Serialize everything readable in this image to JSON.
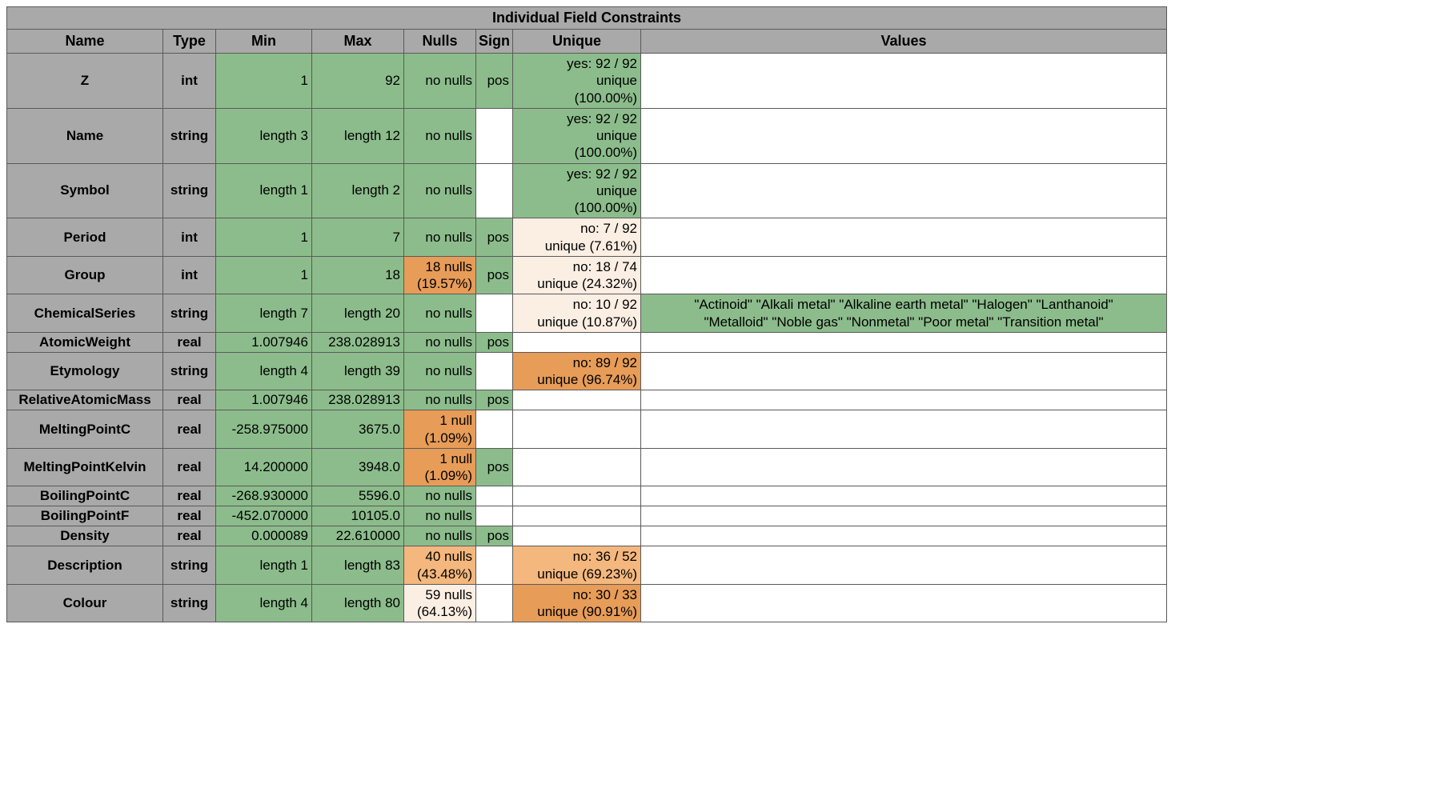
{
  "title": "Individual Field Constraints",
  "headers": {
    "name": "Name",
    "type": "Type",
    "min": "Min",
    "max": "Max",
    "nulls": "Nulls",
    "sign": "Sign",
    "unique": "Unique",
    "values": "Values"
  },
  "rows": [
    {
      "name": "Z",
      "type": "int",
      "min": {
        "t": "1",
        "c": "g"
      },
      "max": {
        "t": "92",
        "c": "g"
      },
      "nulls": {
        "t": "no nulls",
        "c": "g"
      },
      "sign": {
        "t": "pos",
        "c": "g"
      },
      "unique": {
        "t": "yes: 92 / 92\nunique\n(100.00%)",
        "c": "g"
      },
      "values": {
        "t": "",
        "c": "w"
      }
    },
    {
      "name": "Name",
      "type": "string",
      "min": {
        "t": "length 3",
        "c": "g"
      },
      "max": {
        "t": "length 12",
        "c": "g"
      },
      "nulls": {
        "t": "no nulls",
        "c": "g"
      },
      "sign": {
        "t": "",
        "c": "w"
      },
      "unique": {
        "t": "yes: 92 / 92\nunique\n(100.00%)",
        "c": "g"
      },
      "values": {
        "t": "",
        "c": "w"
      }
    },
    {
      "name": "Symbol",
      "type": "string",
      "min": {
        "t": "length 1",
        "c": "g"
      },
      "max": {
        "t": "length 2",
        "c": "g"
      },
      "nulls": {
        "t": "no nulls",
        "c": "g"
      },
      "sign": {
        "t": "",
        "c": "w"
      },
      "unique": {
        "t": "yes: 92 / 92\nunique\n(100.00%)",
        "c": "g"
      },
      "values": {
        "t": "",
        "c": "w"
      }
    },
    {
      "name": "Period",
      "type": "int",
      "min": {
        "t": "1",
        "c": "g"
      },
      "max": {
        "t": "7",
        "c": "g"
      },
      "nulls": {
        "t": "no nulls",
        "c": "g"
      },
      "sign": {
        "t": "pos",
        "c": "g"
      },
      "unique": {
        "t": "no: 7 / 92\nunique (7.61%)",
        "c": "vlo"
      },
      "values": {
        "t": "",
        "c": "w"
      }
    },
    {
      "name": "Group",
      "type": "int",
      "min": {
        "t": "1",
        "c": "g"
      },
      "max": {
        "t": "18",
        "c": "g"
      },
      "nulls": {
        "t": "18 nulls\n(19.57%)",
        "c": "o"
      },
      "sign": {
        "t": "pos",
        "c": "g"
      },
      "unique": {
        "t": "no: 18 / 74\nunique (24.32%)",
        "c": "vlo"
      },
      "values": {
        "t": "",
        "c": "w"
      }
    },
    {
      "name": "ChemicalSeries",
      "type": "string",
      "min": {
        "t": "length 7",
        "c": "g"
      },
      "max": {
        "t": "length 20",
        "c": "g"
      },
      "nulls": {
        "t": "no nulls",
        "c": "g"
      },
      "sign": {
        "t": "",
        "c": "w"
      },
      "unique": {
        "t": "no: 10 / 92\nunique (10.87%)",
        "c": "vlo"
      },
      "values": {
        "t": "\"Actinoid\" \"Alkali metal\" \"Alkaline earth metal\" \"Halogen\" \"Lanthanoid\"\n\"Metalloid\" \"Noble gas\" \"Nonmetal\" \"Poor metal\" \"Transition metal\"",
        "c": "g",
        "align": "center"
      }
    },
    {
      "name": "AtomicWeight",
      "type": "real",
      "min": {
        "t": "1.007946",
        "c": "g"
      },
      "max": {
        "t": "238.028913",
        "c": "g"
      },
      "nulls": {
        "t": "no nulls",
        "c": "g"
      },
      "sign": {
        "t": "pos",
        "c": "g"
      },
      "unique": {
        "t": "",
        "c": "w"
      },
      "values": {
        "t": "",
        "c": "w"
      }
    },
    {
      "name": "Etymology",
      "type": "string",
      "min": {
        "t": "length 4",
        "c": "g"
      },
      "max": {
        "t": "length 39",
        "c": "g"
      },
      "nulls": {
        "t": "no nulls",
        "c": "g"
      },
      "sign": {
        "t": "",
        "c": "w"
      },
      "unique": {
        "t": "no: 89 / 92\nunique (96.74%)",
        "c": "o"
      },
      "values": {
        "t": "",
        "c": "w"
      }
    },
    {
      "name": "RelativeAtomicMass",
      "type": "real",
      "min": {
        "t": "1.007946",
        "c": "g"
      },
      "max": {
        "t": "238.028913",
        "c": "g"
      },
      "nulls": {
        "t": "no nulls",
        "c": "g"
      },
      "sign": {
        "t": "pos",
        "c": "g"
      },
      "unique": {
        "t": "",
        "c": "w"
      },
      "values": {
        "t": "",
        "c": "w"
      }
    },
    {
      "name": "MeltingPointC",
      "type": "real",
      "min": {
        "t": "-258.975000",
        "c": "g"
      },
      "max": {
        "t": "3675.0",
        "c": "g"
      },
      "nulls": {
        "t": "1 null\n(1.09%)",
        "c": "o"
      },
      "sign": {
        "t": "",
        "c": "w"
      },
      "unique": {
        "t": "",
        "c": "w"
      },
      "values": {
        "t": "",
        "c": "w"
      }
    },
    {
      "name": "MeltingPointKelvin",
      "type": "real",
      "min": {
        "t": "14.200000",
        "c": "g"
      },
      "max": {
        "t": "3948.0",
        "c": "g"
      },
      "nulls": {
        "t": "1 null\n(1.09%)",
        "c": "o"
      },
      "sign": {
        "t": "pos",
        "c": "g"
      },
      "unique": {
        "t": "",
        "c": "w"
      },
      "values": {
        "t": "",
        "c": "w"
      }
    },
    {
      "name": "BoilingPointC",
      "type": "real",
      "min": {
        "t": "-268.930000",
        "c": "g"
      },
      "max": {
        "t": "5596.0",
        "c": "g"
      },
      "nulls": {
        "t": "no nulls",
        "c": "g"
      },
      "sign": {
        "t": "",
        "c": "w"
      },
      "unique": {
        "t": "",
        "c": "w"
      },
      "values": {
        "t": "",
        "c": "w"
      }
    },
    {
      "name": "BoilingPointF",
      "type": "real",
      "min": {
        "t": "-452.070000",
        "c": "g"
      },
      "max": {
        "t": "10105.0",
        "c": "g"
      },
      "nulls": {
        "t": "no nulls",
        "c": "g"
      },
      "sign": {
        "t": "",
        "c": "w"
      },
      "unique": {
        "t": "",
        "c": "w"
      },
      "values": {
        "t": "",
        "c": "w"
      }
    },
    {
      "name": "Density",
      "type": "real",
      "min": {
        "t": "0.000089",
        "c": "g"
      },
      "max": {
        "t": "22.610000",
        "c": "g"
      },
      "nulls": {
        "t": "no nulls",
        "c": "g"
      },
      "sign": {
        "t": "pos",
        "c": "g"
      },
      "unique": {
        "t": "",
        "c": "w"
      },
      "values": {
        "t": "",
        "c": "w"
      }
    },
    {
      "name": "Description",
      "type": "string",
      "min": {
        "t": "length 1",
        "c": "g"
      },
      "max": {
        "t": "length 83",
        "c": "g"
      },
      "nulls": {
        "t": "40 nulls\n(43.48%)",
        "c": "lo"
      },
      "sign": {
        "t": "",
        "c": "w"
      },
      "unique": {
        "t": "no: 36 / 52\nunique (69.23%)",
        "c": "lo"
      },
      "values": {
        "t": "",
        "c": "w"
      }
    },
    {
      "name": "Colour",
      "type": "string",
      "min": {
        "t": "length 4",
        "c": "g"
      },
      "max": {
        "t": "length 80",
        "c": "g"
      },
      "nulls": {
        "t": "59 nulls\n(64.13%)",
        "c": "vlo"
      },
      "sign": {
        "t": "",
        "c": "w"
      },
      "unique": {
        "t": "no: 30 / 33\nunique (90.91%)",
        "c": "o"
      },
      "values": {
        "t": "",
        "c": "w"
      }
    }
  ]
}
